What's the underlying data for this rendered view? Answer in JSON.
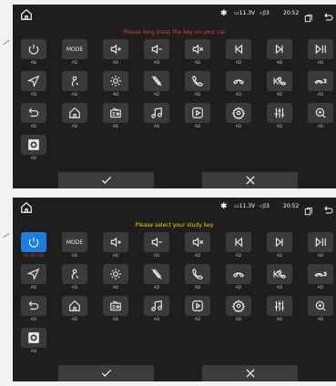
{
  "status_bar": {
    "bluetooth_glyph": "✱",
    "battery": "11.3V",
    "volume": "3",
    "time": "20:52"
  },
  "screens": [
    {
      "prompt": "Please long press the key on your car",
      "prompt_color": "#e23b3b",
      "selected_label": "AD"
    },
    {
      "prompt": "Please select your study key",
      "prompt_color": "#f2d500",
      "selected_label": "23-40-182"
    }
  ],
  "keys": [
    {
      "name": "power",
      "label": "AD"
    },
    {
      "name": "mode",
      "label": "AD",
      "text": "MODE"
    },
    {
      "name": "volume-up",
      "label": "AD"
    },
    {
      "name": "volume-down",
      "label": "AD"
    },
    {
      "name": "mute",
      "label": "AD"
    },
    {
      "name": "previous-track",
      "label": "AD"
    },
    {
      "name": "next-track",
      "label": "AD"
    },
    {
      "name": "play-pause",
      "label": "AD"
    },
    {
      "name": "navigation",
      "label": "AD"
    },
    {
      "name": "voice",
      "label": "AD"
    },
    {
      "name": "brightness",
      "label": "AD"
    },
    {
      "name": "mic-off",
      "label": "AD"
    },
    {
      "name": "call-answer",
      "label": "AD"
    },
    {
      "name": "call-hangup",
      "label": "AD"
    },
    {
      "name": "call-previous",
      "label": "AD"
    },
    {
      "name": "call-next",
      "label": "AD"
    },
    {
      "name": "back",
      "label": "AD"
    },
    {
      "name": "home",
      "label": "AD"
    },
    {
      "name": "radio",
      "label": "AD"
    },
    {
      "name": "music",
      "label": "AD"
    },
    {
      "name": "video",
      "label": "AD"
    },
    {
      "name": "settings",
      "label": "AD"
    },
    {
      "name": "equalizer",
      "label": "AD"
    },
    {
      "name": "search",
      "label": "AD"
    },
    {
      "name": "camera",
      "label": "AD"
    }
  ],
  "buttons": {
    "confirm_glyph": "✓",
    "cancel_glyph": "✕"
  },
  "colors": {
    "screen_bg": "#1e1e1e",
    "key_bg": "#3a3a3a",
    "key_active": "#1e7ee0",
    "label_gray": "#bbbbbb"
  }
}
